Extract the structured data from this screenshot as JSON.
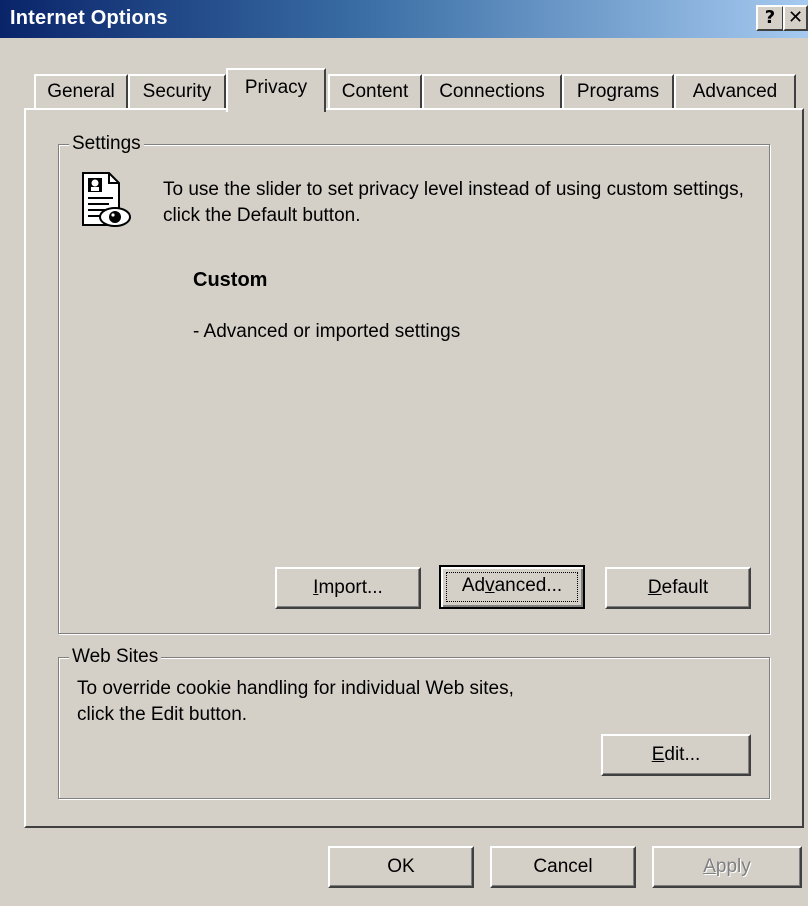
{
  "window": {
    "title": "Internet Options",
    "help_glyph": "?",
    "close_glyph": "✕"
  },
  "tabs": [
    {
      "label": "General"
    },
    {
      "label": "Security"
    },
    {
      "label": "Privacy",
      "active": true
    },
    {
      "label": "Content"
    },
    {
      "label": "Connections"
    },
    {
      "label": "Programs"
    },
    {
      "label": "Advanced"
    }
  ],
  "settings": {
    "group_label": "Settings",
    "icon": "privacy-document-eye-icon",
    "description": "To use the slider to set privacy level instead of using custom settings, click the Default button.",
    "level_title": "Custom",
    "level_description": "- Advanced or imported settings",
    "buttons": {
      "import": {
        "pre": "",
        "accel": "I",
        "post": "mport..."
      },
      "advanced": {
        "pre": "Ad",
        "accel": "v",
        "post": "anced..."
      },
      "default": {
        "pre": "",
        "accel": "D",
        "post": "efault"
      }
    }
  },
  "web_sites": {
    "group_label": "Web Sites",
    "description_line1": "To override cookie handling for individual Web sites,",
    "description_line2": "click the Edit button.",
    "edit": {
      "pre": "",
      "accel": "E",
      "post": "dit..."
    }
  },
  "dialog_buttons": {
    "ok": "OK",
    "cancel": "Cancel",
    "apply": {
      "pre": "",
      "accel": "A",
      "post": "pply",
      "disabled": true
    }
  }
}
